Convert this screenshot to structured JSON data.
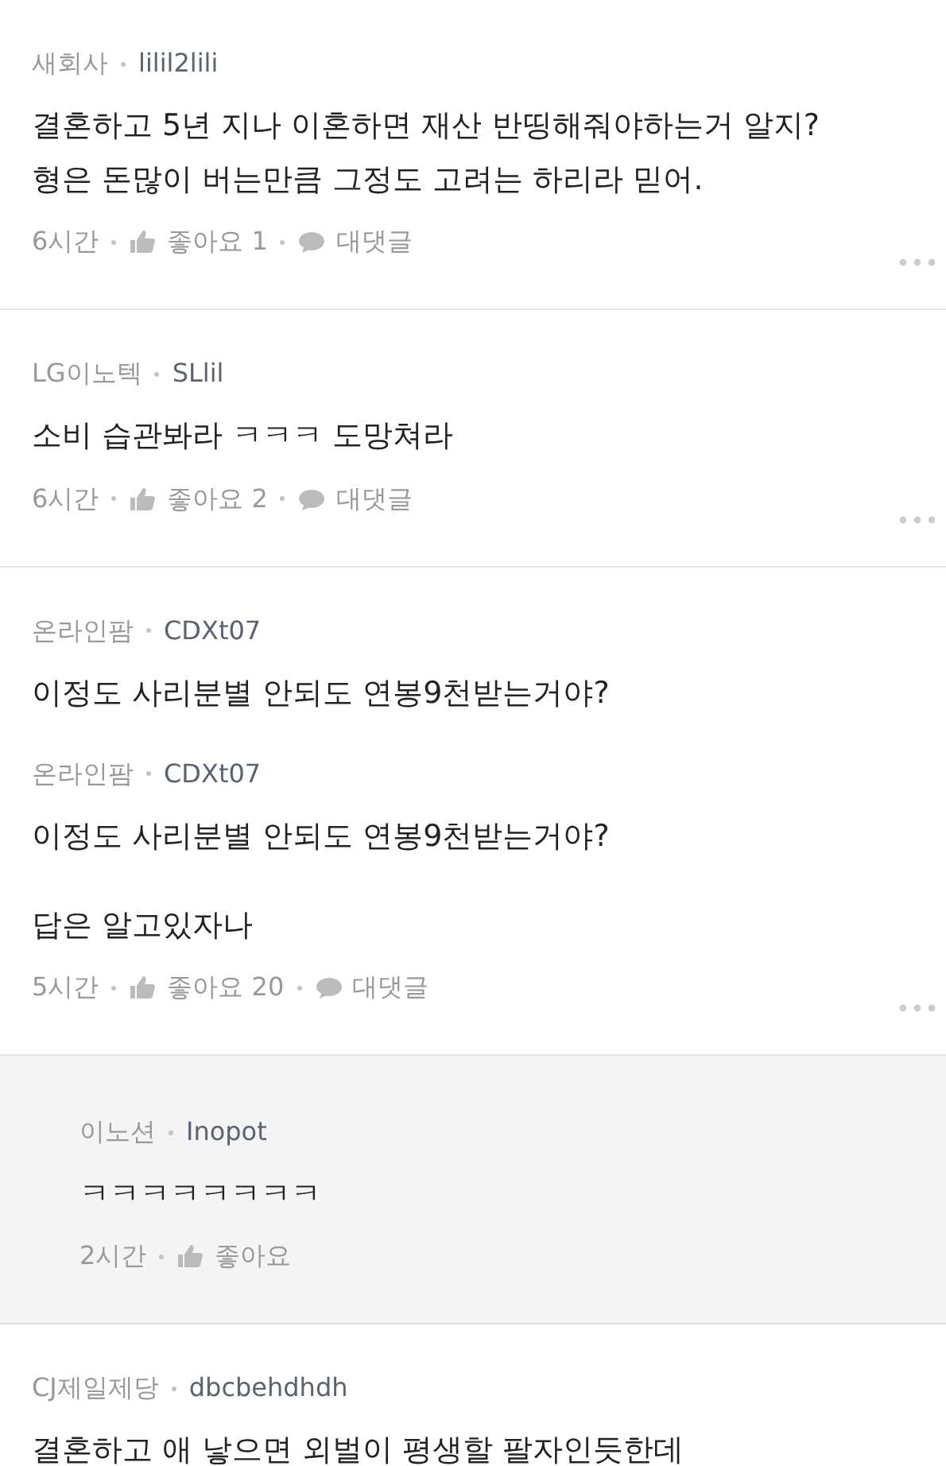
{
  "comments": [
    {
      "reply": false,
      "blocks": [
        {
          "kind": "author",
          "company": "새회사",
          "user": "lilil2lili"
        },
        {
          "kind": "text",
          "text": "결혼하고 5년 지나 이혼하면 재산 반띵해줘야하는거 알지?\n형은 돈많이 버는만큼 그정도 고려는 하리라 믿어."
        }
      ],
      "footer": {
        "time": "6시간",
        "like": "좋아요 1",
        "reply": "대댓글"
      }
    },
    {
      "reply": false,
      "blocks": [
        {
          "kind": "author",
          "company": "LG이노텍",
          "user": "SLlil"
        },
        {
          "kind": "text",
          "text": "소비 습관봐라 ㅋㅋㅋ 도망쳐라"
        }
      ],
      "footer": {
        "time": "6시간",
        "like": "좋아요 2",
        "reply": "대댓글"
      }
    },
    {
      "reply": false,
      "blocks": [
        {
          "kind": "author",
          "company": "온라인팜",
          "user": "CDXt07"
        },
        {
          "kind": "text",
          "text": "이정도 사리분별 안되도 연봉9천받는거야?"
        },
        {
          "kind": "author",
          "company": "온라인팜",
          "user": "CDXt07"
        },
        {
          "kind": "text",
          "text": "이정도 사리분별 안되도 연봉9천받는거야?"
        },
        {
          "kind": "text",
          "text": "답은 알고있자나"
        }
      ],
      "footer": {
        "time": "5시간",
        "like": "좋아요 20",
        "reply": "대댓글"
      }
    },
    {
      "reply": true,
      "blocks": [
        {
          "kind": "author",
          "company": "이노션",
          "user": "Inopot"
        },
        {
          "kind": "text",
          "text": "ㅋㅋㅋㅋㅋㅋㅋㅋ"
        }
      ],
      "footer": {
        "time": "2시간",
        "like": "좋아요"
      }
    },
    {
      "reply": false,
      "blocks": [
        {
          "kind": "author",
          "company": "CJ제일제당",
          "user": "dbcbehdhdh"
        },
        {
          "kind": "text",
          "text": "결혼하고 애 낳으면 외벌이 평생할 팔자인듯한데"
        }
      ]
    }
  ]
}
